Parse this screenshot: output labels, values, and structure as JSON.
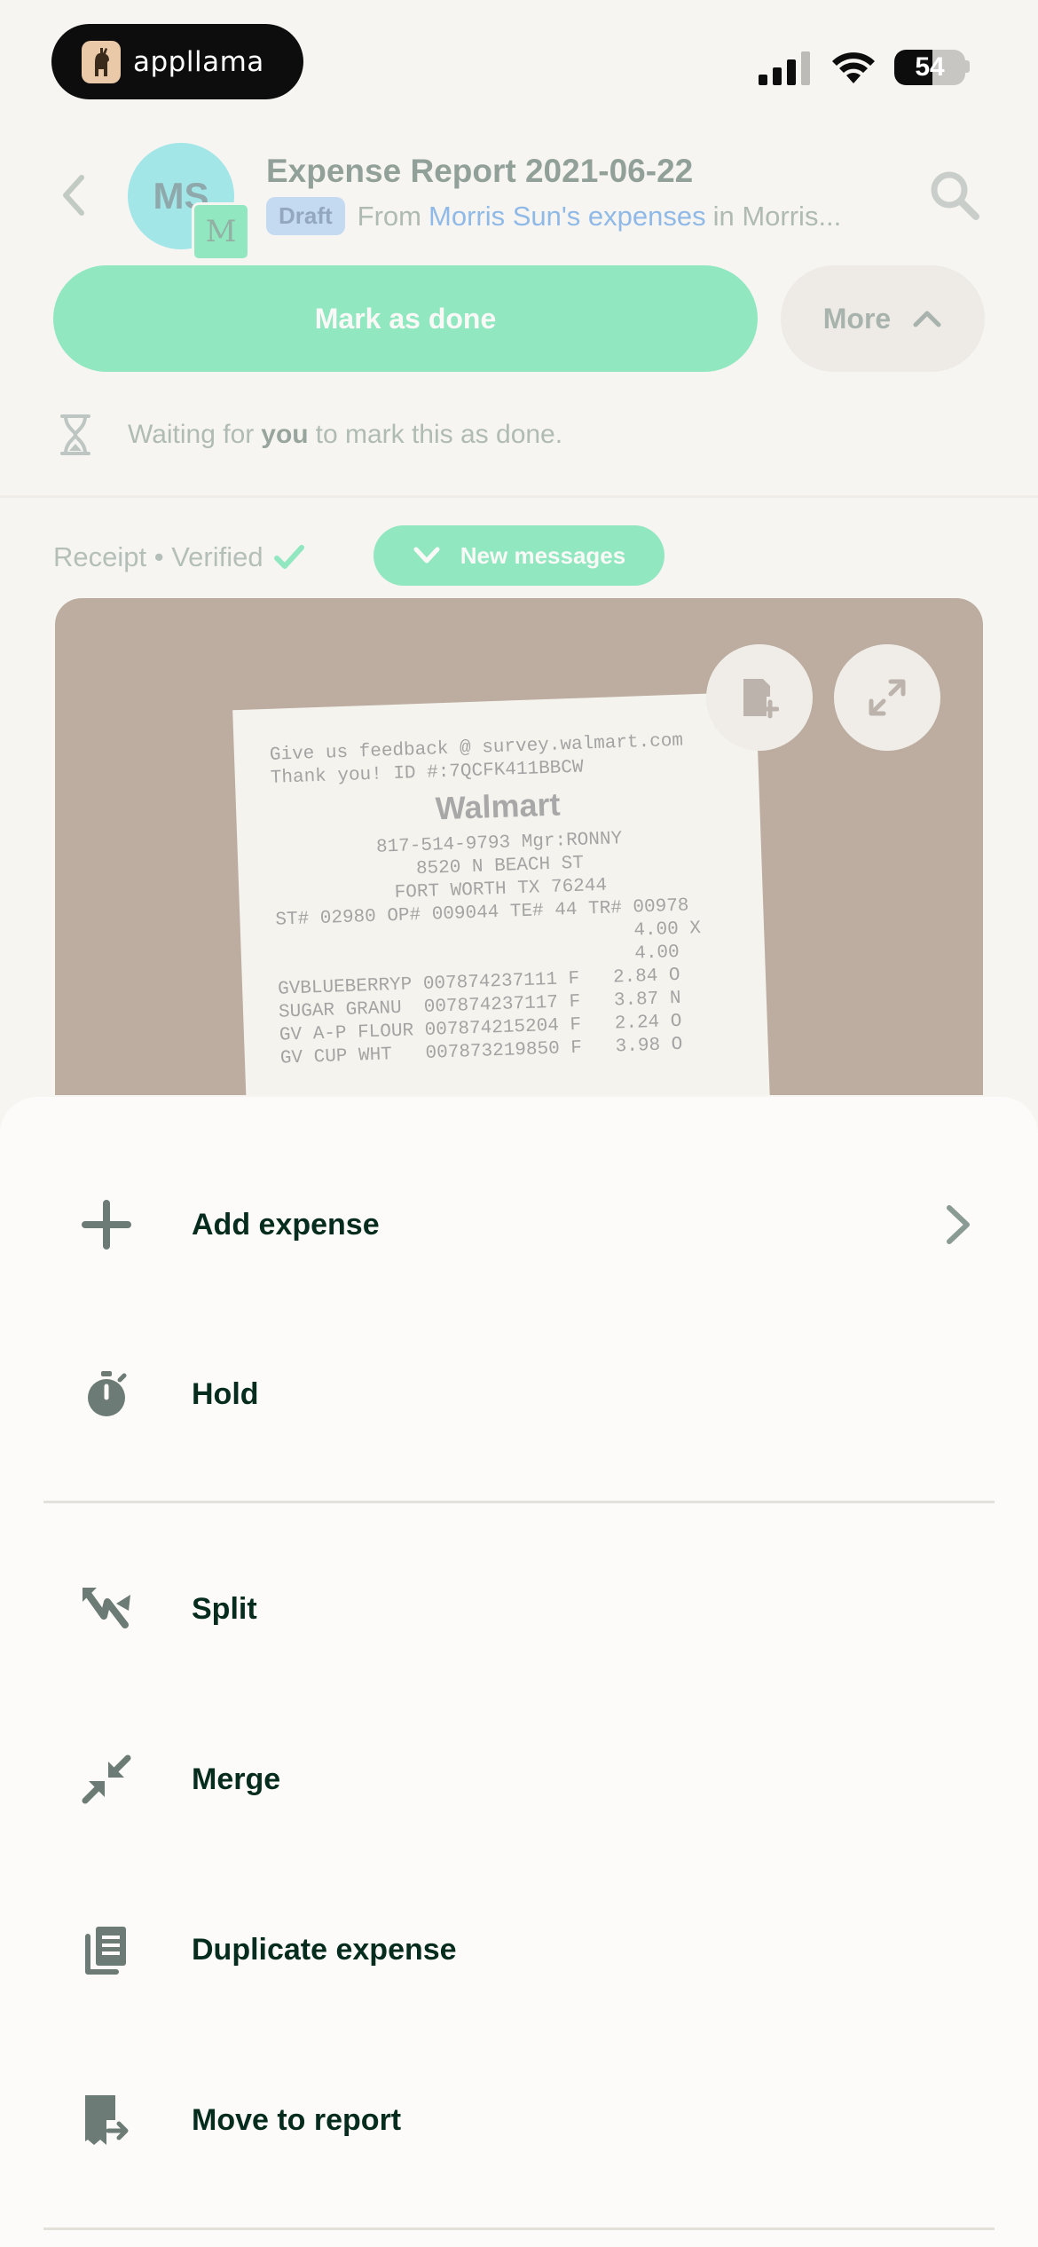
{
  "status_bar": {
    "app_brand": "appllama",
    "battery_level": "54"
  },
  "header": {
    "avatar_initials": "MS",
    "workspace_initial": "M",
    "title": "Expense Report 2021-06-22",
    "draft_badge": "Draft",
    "from_prefix": "From",
    "from_link": "Morris Sun's expenses",
    "in_text": "in Morris..."
  },
  "actions": {
    "mark_done": "Mark as done",
    "more": "More"
  },
  "waiting": {
    "prefix": "Waiting for",
    "you": "you",
    "suffix": "to mark this as done."
  },
  "receipt": {
    "label": "Receipt • Verified",
    "new_messages": "New messages",
    "lines_top": [
      "Give us feedback @ survey.walmart.com",
      "Thank you! ID #:7QCFK411BBCW"
    ],
    "store": "Walmart",
    "lines_center": [
      "817-514-9793 Mgr:RONNY",
      "8520 N BEACH ST",
      "FORT WORTH TX 76244"
    ],
    "lines_items": [
      "ST# 02980 OP# 009044 TE# 44 TR# 00978",
      "                                4.00 X",
      "                                4.00",
      "GVBLUEBERRYP 007874237111 F   2.84 O",
      "SUGAR GRANU  007874237117 F   3.87 N",
      "GV A-P FLOUR 007874215204 F   2.24 O",
      "GV CUP WHT   007873219850 F   3.98 O"
    ]
  },
  "sheet": {
    "items": [
      {
        "label": "Add expense"
      },
      {
        "label": "Hold"
      },
      {
        "label": "Split"
      },
      {
        "label": "Merge"
      },
      {
        "label": "Duplicate expense"
      },
      {
        "label": "Move to report"
      }
    ]
  }
}
